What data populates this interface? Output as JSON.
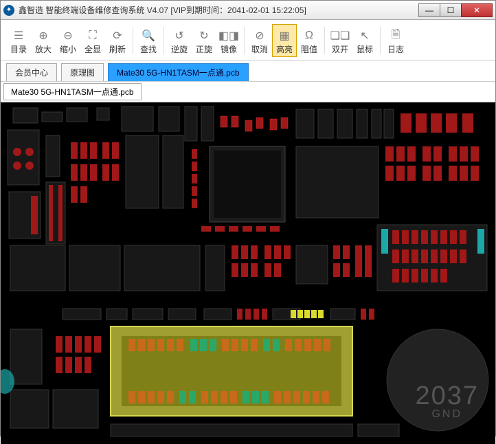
{
  "window": {
    "title": "鑫智造 智能终端设备维修查询系统 V4.07 [VIP到期时间：2041-02-01 15:22:05]"
  },
  "toolbar": [
    {
      "icon": "list",
      "label": "目录"
    },
    {
      "icon": "zin",
      "label": "放大"
    },
    {
      "icon": "zout",
      "label": "缩小"
    },
    {
      "icon": "fit",
      "label": "全显"
    },
    {
      "icon": "refresh",
      "label": "刷新"
    },
    {
      "sep": true
    },
    {
      "icon": "search",
      "label": "查找"
    },
    {
      "sep": true
    },
    {
      "icon": "ccw",
      "label": "逆旋"
    },
    {
      "icon": "cw",
      "label": "正旋"
    },
    {
      "icon": "mirror",
      "label": "镜像"
    },
    {
      "sep": true
    },
    {
      "icon": "cancel",
      "label": "取消"
    },
    {
      "icon": "highlight",
      "label": "高亮",
      "active": true
    },
    {
      "icon": "ohm",
      "label": "阻值"
    },
    {
      "sep": true
    },
    {
      "icon": "dual",
      "label": "双开"
    },
    {
      "icon": "cursor",
      "label": "鼠标"
    },
    {
      "sep": true
    },
    {
      "icon": "log",
      "label": "日志"
    }
  ],
  "tabs": [
    {
      "label": "会员中心"
    },
    {
      "label": "原理图"
    },
    {
      "label": "Mate30 5G-HN1TASM一点通.pcb",
      "selected": true
    }
  ],
  "filetab": "Mate30 5G-HN1TASM一点通.pcb",
  "pcb_label": {
    "id": "2037",
    "net": "GND"
  }
}
